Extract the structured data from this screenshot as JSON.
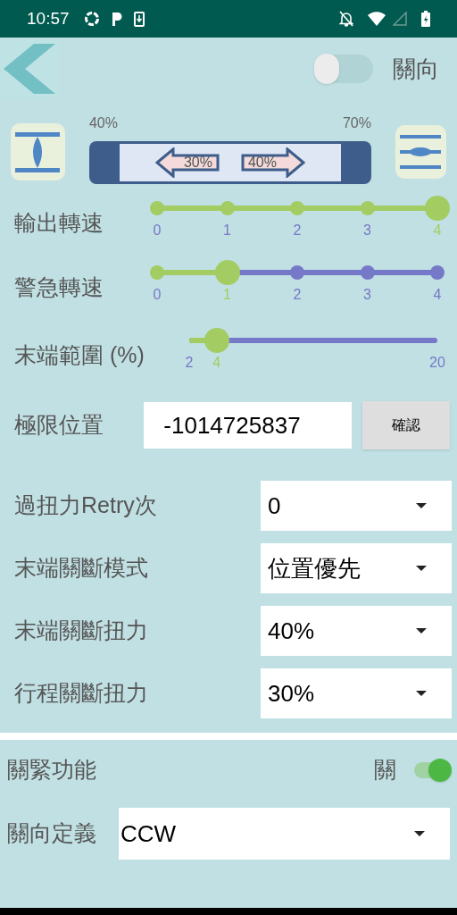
{
  "status_bar": {
    "time": "10:57"
  },
  "header": {
    "direction_switch": {
      "on": false,
      "label": "關向"
    }
  },
  "valve": {
    "left_percent": "40%",
    "right_percent": "70%",
    "close_arrow": "30%",
    "open_arrow": "40%"
  },
  "sliders": [
    {
      "label": "輸出轉速",
      "kind": "discrete",
      "level": 1,
      "ticks": [
        {
          "label": "0",
          "selected": false
        },
        {
          "label": "1",
          "selected": false
        },
        {
          "label": "2",
          "selected": false
        },
        {
          "label": "3",
          "selected": false
        },
        {
          "label": "4",
          "selected": true
        }
      ]
    },
    {
      "label": "警急轉速",
      "kind": "discrete",
      "level": 0.25,
      "ticks": [
        {
          "label": "0",
          "selected": false
        },
        {
          "label": "1",
          "selected": true
        },
        {
          "label": "2",
          "selected": false
        },
        {
          "label": "3",
          "selected": false
        },
        {
          "label": "4",
          "selected": false
        }
      ]
    },
    {
      "label": "末端範圍 (%)",
      "kind": "continuous",
      "level": 0.11,
      "min_label": "2",
      "value_label": "4",
      "max_label": "20"
    }
  ],
  "limit_position": {
    "label": "極限位置",
    "value": "-1014725837",
    "button": "確認"
  },
  "dropdowns": [
    {
      "label": "過扭力Retry次",
      "value": "0"
    },
    {
      "label": "末端關斷模式",
      "value": "位置優先"
    },
    {
      "label": "末端關斷扭力",
      "value": "40%"
    },
    {
      "label": "行程關斷扭力",
      "value": "30%"
    }
  ],
  "tighten": {
    "label": "關緊功能",
    "state_label": "關",
    "on": true
  },
  "direction_definition": {
    "label": "關向定義",
    "value": "CCW"
  }
}
